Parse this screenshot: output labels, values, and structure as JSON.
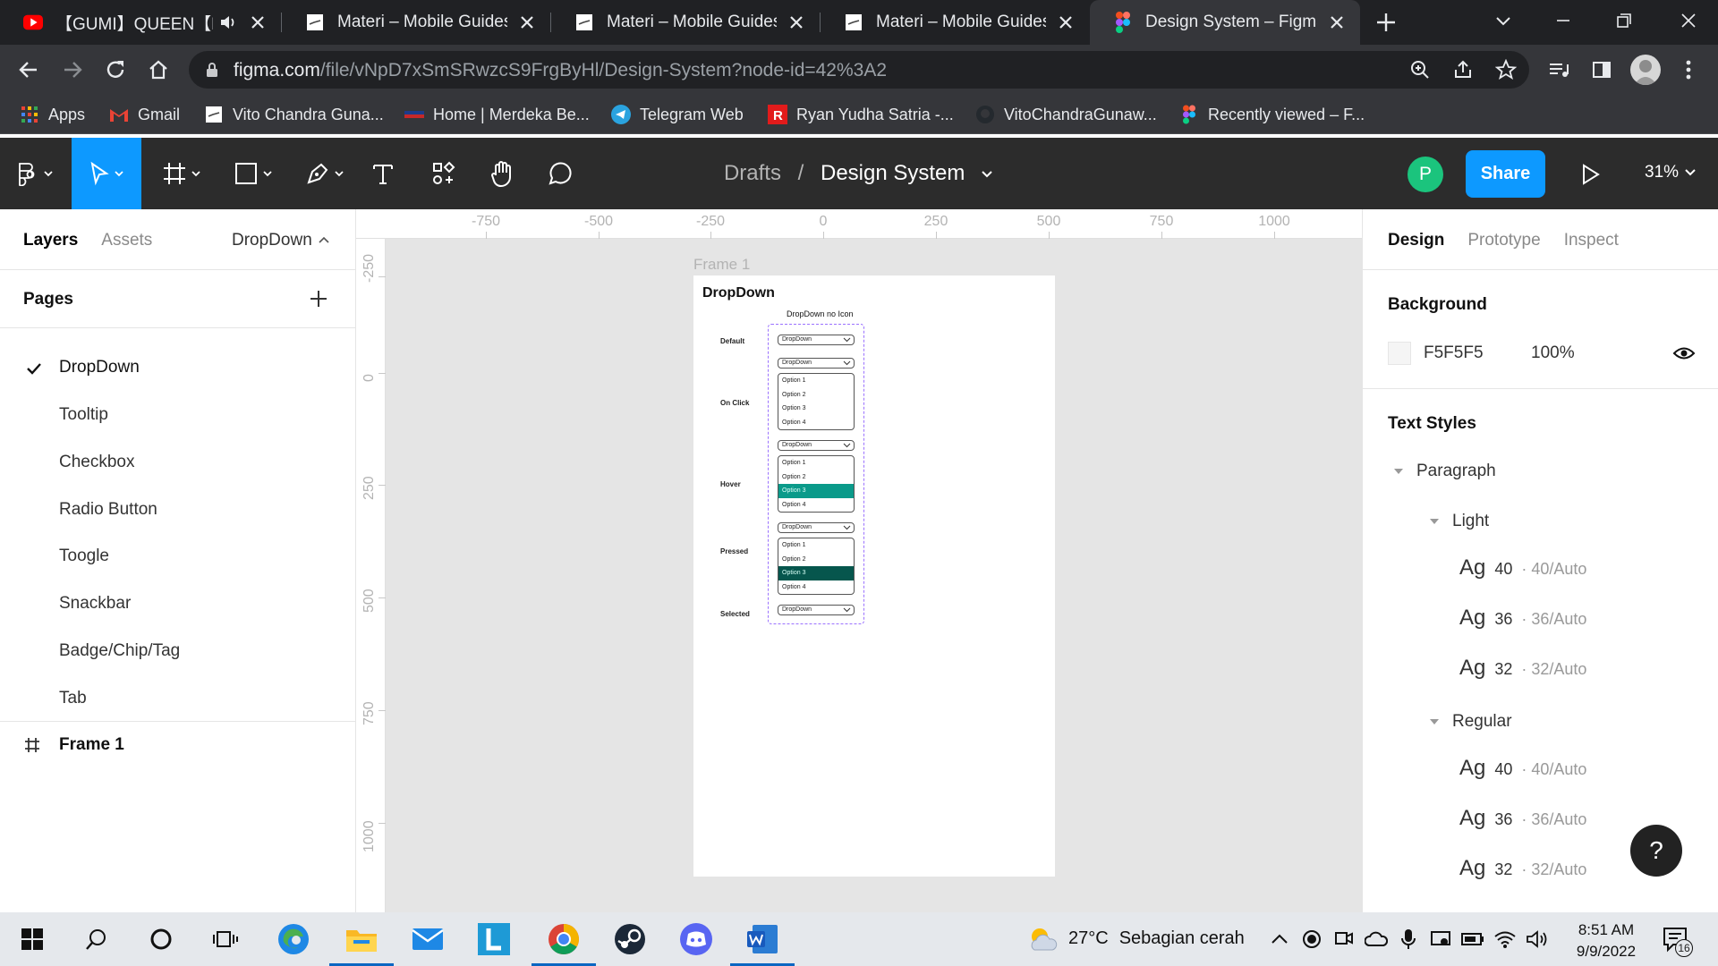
{
  "browser": {
    "tabs": [
      {
        "title": "【GUMI】QUEEN【Kanaria】",
        "icon": "youtube-icon",
        "audio": true
      },
      {
        "title": "Materi – Mobile Guides",
        "icon": "document-icon"
      },
      {
        "title": "Materi – Mobile Guides (Copy)",
        "icon": "document-icon"
      },
      {
        "title": "Materi – Mobile Guides (Copy)",
        "icon": "document-icon"
      },
      {
        "title": "Design System – Figma",
        "icon": "figma-icon",
        "active": true
      }
    ],
    "url_host": "figma.com",
    "url_path": "/file/vNpD7xSmSRwzcS9FrgByHl/Design-System?node-id=42%3A2",
    "bookmarks": [
      {
        "label": "Apps",
        "icon": "apps-grid-icon"
      },
      {
        "label": "Gmail",
        "icon": "gmail-icon"
      },
      {
        "label": "Vito Chandra Guna...",
        "icon": "page-icon"
      },
      {
        "label": "Home | Merdeka Be...",
        "icon": "page-icon"
      },
      {
        "label": "Telegram Web",
        "icon": "telegram-icon"
      },
      {
        "label": "Ryan Yudha Satria -...",
        "icon": "r-icon"
      },
      {
        "label": "VitoChandraGunaw...",
        "icon": "github-icon"
      },
      {
        "label": "Recently viewed – F...",
        "icon": "figma-icon"
      }
    ]
  },
  "figma": {
    "breadcrumb_parent": "Drafts",
    "breadcrumb_separator": "/",
    "file_name": "Design System",
    "avatar_initial": "P",
    "share_label": "Share",
    "zoom": "31%"
  },
  "left_panel": {
    "tab_layers": "Layers",
    "tab_assets": "Assets",
    "current_page": "DropDown",
    "pages_title": "Pages",
    "pages": [
      "DropDown",
      "Tooltip",
      "Checkbox",
      "Radio Button",
      "Toogle",
      "Snackbar",
      "Badge/Chip/Tag",
      "Tab"
    ],
    "layer_frame": "Frame 1"
  },
  "canvas": {
    "ruler_top": [
      "-750",
      "-500",
      "-250",
      "0",
      "250",
      "500",
      "750",
      "1000"
    ],
    "ruler_left": [
      "-250",
      "0",
      "250",
      "500",
      "750",
      "1000"
    ],
    "frame_label": "Frame 1",
    "frame_title": "DropDown",
    "frame_subtitle": "DropDown no Icon",
    "states": [
      "Default",
      "On Click",
      "Hover",
      "Pressed",
      "Selected"
    ],
    "dropdown_label": "DropDown",
    "options": [
      "Option 1",
      "Option 2",
      "Option 3",
      "Option 4"
    ],
    "hover_color": "#0a9a8a",
    "pressed_color": "#06564d"
  },
  "right_panel": {
    "tab_design": "Design",
    "tab_prototype": "Prototype",
    "tab_inspect": "Inspect",
    "background_title": "Background",
    "background_hex": "F5F5F5",
    "background_opacity": "100%",
    "text_styles_title": "Text Styles",
    "group_paragraph": "Paragraph",
    "group_light": "Light",
    "group_regular": "Regular",
    "sample": "Ag",
    "light_styles": [
      {
        "size": "40",
        "lh": "· 40/Auto"
      },
      {
        "size": "36",
        "lh": "· 36/Auto"
      },
      {
        "size": "32",
        "lh": "· 32/Auto"
      }
    ],
    "regular_styles": [
      {
        "size": "40",
        "lh": "· 40/Auto"
      },
      {
        "size": "36",
        "lh": "· 36/Auto"
      },
      {
        "size": "32",
        "lh": "· 32/Auto"
      }
    ],
    "help_label": "?"
  },
  "taskbar": {
    "weather_temp": "27°C",
    "weather_text": "Sebagian cerah",
    "time": "8:51 AM",
    "date": "9/9/2022",
    "notification_count": "16"
  }
}
